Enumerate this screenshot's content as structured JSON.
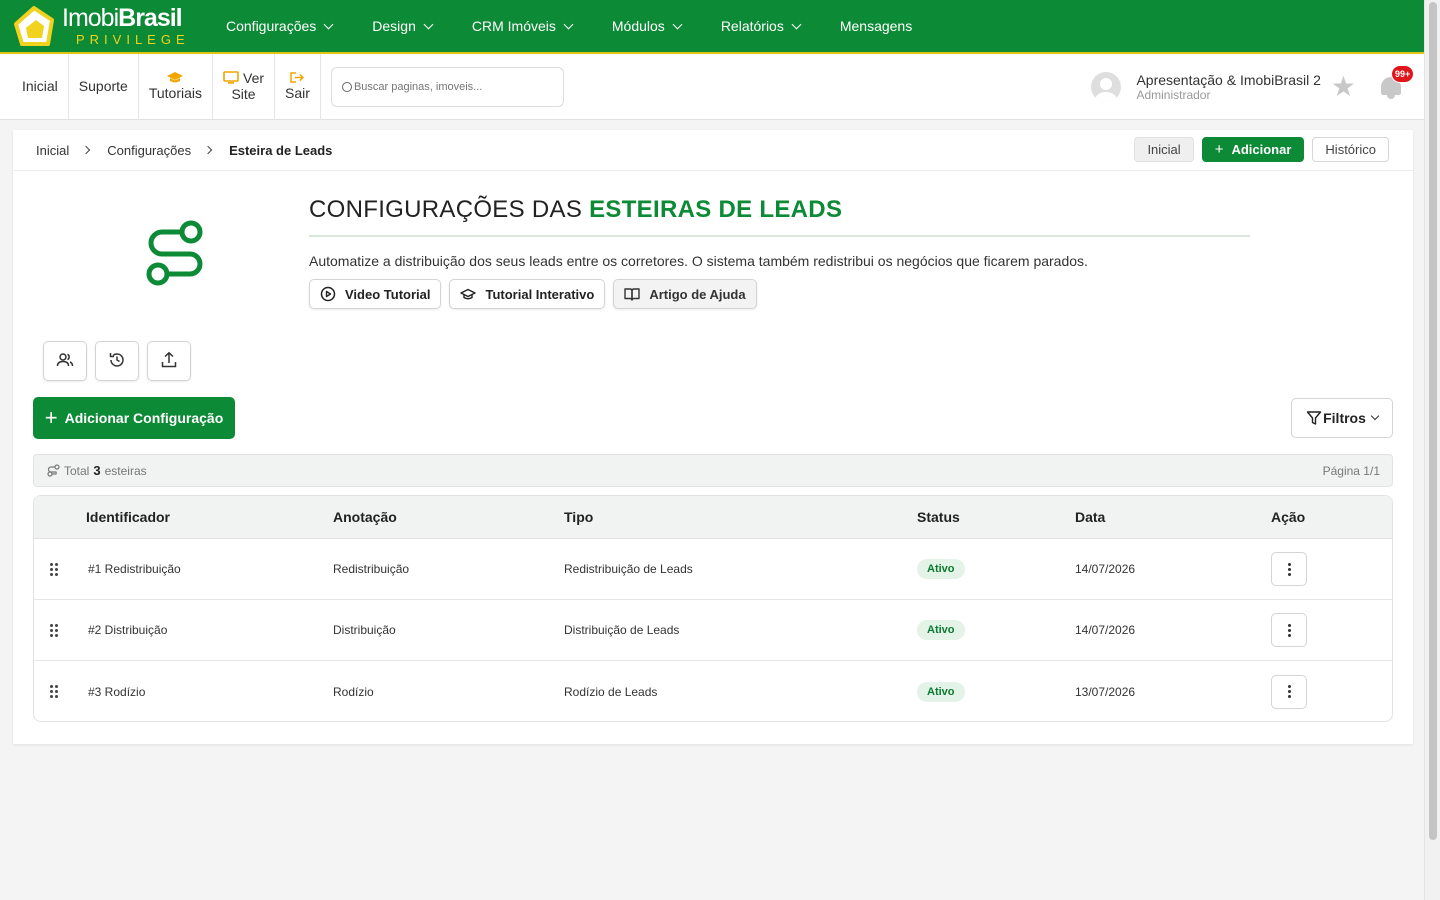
{
  "brand": {
    "name_light": "Imobi",
    "name_bold": "Brasil",
    "tagline": "PRIVILEGE"
  },
  "nav": {
    "items": [
      {
        "label": "Configurações",
        "dropdown": true
      },
      {
        "label": "Design",
        "dropdown": true
      },
      {
        "label": "CRM Imóveis",
        "dropdown": true
      },
      {
        "label": "Módulos",
        "dropdown": true
      },
      {
        "label": "Relatórios",
        "dropdown": true
      },
      {
        "label": "Mensagens",
        "dropdown": false
      }
    ]
  },
  "toolbar": {
    "inicial": "Inicial",
    "suporte": "Suporte",
    "tutoriais": "Tutoriais",
    "ver_site_1": "Ver",
    "ver_site_2": "Site",
    "sair": "Sair",
    "search_placeholder": "Buscar paginas, imoveis..."
  },
  "user": {
    "name": "Apresentação & ImobiBrasil 2",
    "role": "Administrador",
    "notifications": "99+"
  },
  "breadcrumb": {
    "items": [
      "Inicial",
      "Configurações",
      "Esteira de Leads"
    ]
  },
  "header_actions": {
    "inicial": "Inicial",
    "adicionar": "Adicionar",
    "historico": "Histórico"
  },
  "page": {
    "title_prefix": "CONFIGURAÇÕES DAS ",
    "title_accent": "ESTEIRAS DE LEADS",
    "description": "Automatize a distribuição dos seus leads entre os corretores. O sistema também redistribui os negócios que ficarem parados.",
    "help": {
      "video": "Video Tutorial",
      "interativo": "Tutorial Interativo",
      "artigo": "Artigo de Ajuda"
    }
  },
  "actions": {
    "add_config": "Adicionar Configuração",
    "filtros": "Filtros"
  },
  "summary": {
    "total_label": "Total",
    "total_count": "3",
    "total_unit": "esteiras",
    "page": "Página 1/1"
  },
  "table": {
    "columns": [
      "Identificador",
      "Anotação",
      "Tipo",
      "Status",
      "Data",
      "Ação"
    ],
    "rows": [
      {
        "id": "#1 Redistribuição",
        "anotacao": "Redistribuição",
        "tipo": "Redistribuição de Leads",
        "status": "Ativo",
        "data": "14/07/2026"
      },
      {
        "id": "#2 Distribuição",
        "anotacao": "Distribuição",
        "tipo": "Distribuição de Leads",
        "status": "Ativo",
        "data": "14/07/2026"
      },
      {
        "id": "#3 Rodízio",
        "anotacao": "Rodízio",
        "tipo": "Rodízio de Leads",
        "status": "Ativo",
        "data": "13/07/2026"
      }
    ]
  },
  "colors": {
    "brand_green": "#0c8a36",
    "brand_yellow": "#f1d21c",
    "badge_bg": "#e3f3e8",
    "notif_red": "#e0161b"
  },
  "icons": [
    "logo-mark",
    "graduation-cap-icon",
    "monitor-icon",
    "logout-icon",
    "search-icon",
    "star-icon",
    "bell-icon",
    "route-icon",
    "play-circle-icon",
    "graduation-cap-icon",
    "book-open-icon",
    "users-icon",
    "history-icon",
    "upload-icon",
    "plus-icon",
    "filter-icon",
    "route-small-icon",
    "drag-handle-icon",
    "more-vertical-icon"
  ]
}
